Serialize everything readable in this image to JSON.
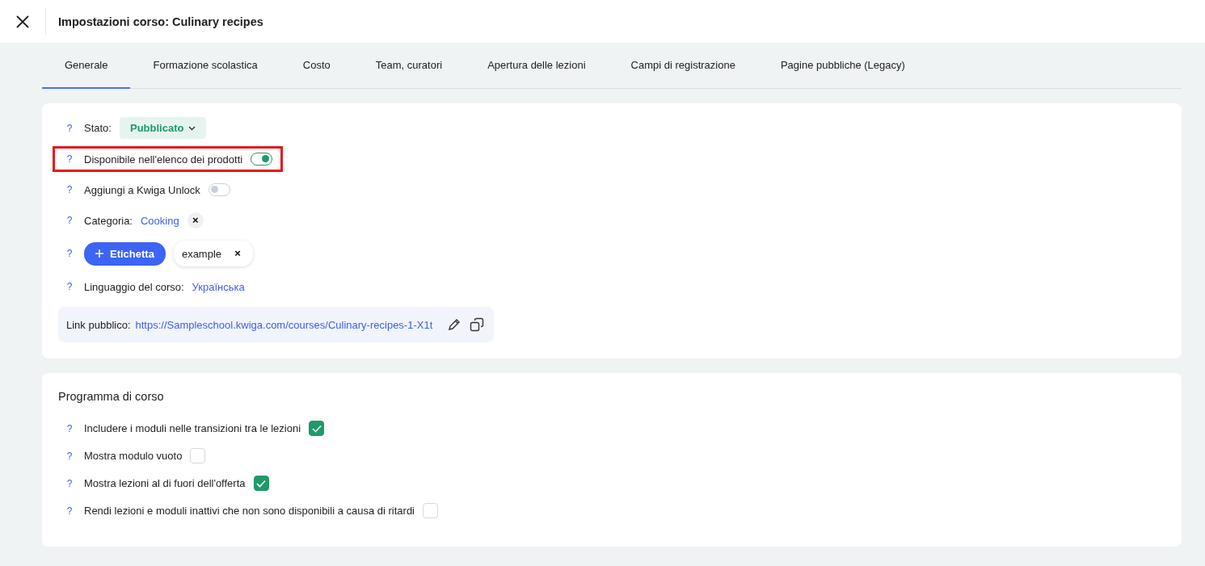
{
  "header": {
    "title": "Impostazioni corso: Culinary recipes"
  },
  "tabs": [
    {
      "label": "Generale",
      "selected": true
    },
    {
      "label": "Formazione scolastica",
      "selected": false
    },
    {
      "label": "Costo",
      "selected": false
    },
    {
      "label": "Team, curatori",
      "selected": false
    },
    {
      "label": "Apertura delle lezioni",
      "selected": false
    },
    {
      "label": "Campi di registrazione",
      "selected": false
    },
    {
      "label": "Pagine pubbliche (Legacy)",
      "selected": false
    }
  ],
  "general": {
    "settings": [
      {
        "kind": "status",
        "help": "?",
        "label": "Stato:",
        "value": "Pubblicato",
        "highlighted": false
      },
      {
        "kind": "toggle",
        "help": "?",
        "label": "Disponibile nell'elenco dei prodotti",
        "on": true,
        "highlighted": true
      },
      {
        "kind": "toggle",
        "help": "?",
        "label": "Aggiungi a Kwiga Unlock",
        "on": false,
        "highlighted": false
      },
      {
        "kind": "category",
        "help": "?",
        "label": "Categoria:",
        "value": "Cooking",
        "remove": "×",
        "highlighted": false
      },
      {
        "kind": "tags",
        "help": "?",
        "button": "Etichetta",
        "tags": [
          {
            "label": "example",
            "remove": "×"
          }
        ],
        "highlighted": false
      },
      {
        "kind": "language",
        "help": "?",
        "label": "Linguaggio del corso:",
        "value": "Українська",
        "highlighted": false
      }
    ],
    "public_link": {
      "label": "Link pubblico:",
      "url": "https://Sampleschool.kwiga.com/courses/Culinary-recipes-1-X1t"
    }
  },
  "program": {
    "title": "Programma di corso",
    "options": [
      {
        "help": "?",
        "label": "Includere i moduli nelle transizioni tra le lezioni",
        "checked": true
      },
      {
        "help": "?",
        "label": "Mostra modulo vuoto",
        "checked": false
      },
      {
        "help": "?",
        "label": "Mostra lezioni al di fuori dell'offerta",
        "checked": true
      },
      {
        "help": "?",
        "label": "Rendi lezioni e moduli inattivi che non sono disponibili a causa di ritardi",
        "checked": false
      }
    ]
  }
}
